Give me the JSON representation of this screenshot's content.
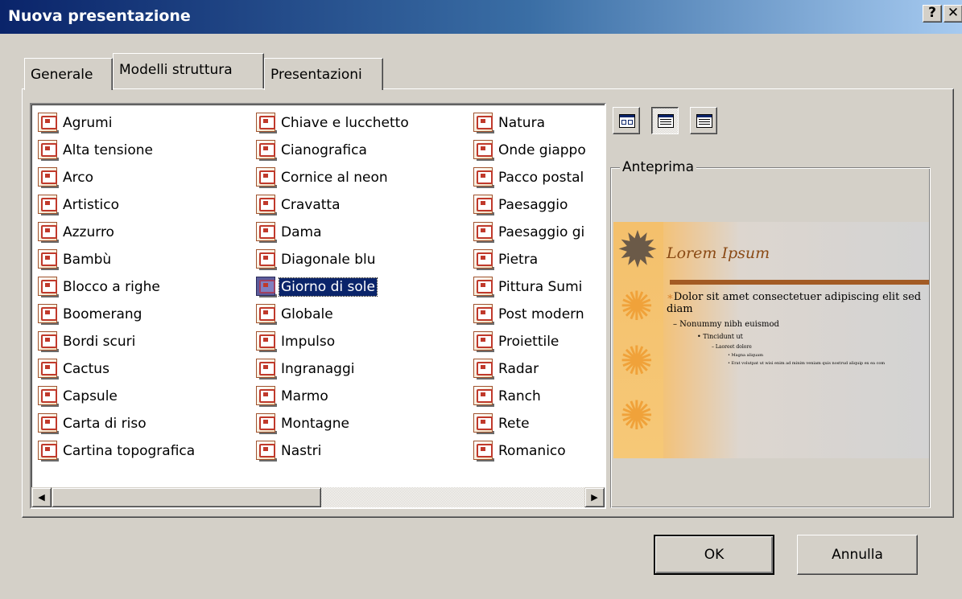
{
  "window": {
    "title": "Nuova presentazione",
    "help_glyph": "?",
    "close_glyph": "✕"
  },
  "tabs": [
    {
      "label": "Generale",
      "active": false
    },
    {
      "label": "Modelli struttura",
      "active": true
    },
    {
      "label": "Presentazioni",
      "active": false
    }
  ],
  "templates": {
    "column_1": [
      "Agrumi",
      "Alta tensione",
      "Arco",
      "Artistico",
      "Azzurro",
      "Bambù",
      "Blocco a righe",
      "Boomerang",
      "Bordi scuri",
      "Cactus",
      "Capsule",
      "Carta di riso",
      "Cartina topografica"
    ],
    "column_2": [
      "Chiave e lucchetto",
      "Cianografica",
      "Cornice al neon",
      "Cravatta",
      "Dama",
      "Diagonale blu",
      "Giorno di sole",
      "Globale",
      "Impulso",
      "Ingranaggi",
      "Marmo",
      "Montagne",
      "Nastri"
    ],
    "column_3": [
      "Natura",
      "Onde giappo",
      "Pacco postal",
      "Paesaggio",
      "Paesaggio gi",
      "Pietra",
      "Pittura Sumi",
      "Post modern",
      "Proiettile",
      "Radar",
      "Ranch",
      "Rete",
      "Romanico"
    ],
    "selected": "Giorno di sole",
    "item_icon": "design-template-icon"
  },
  "scrollbar": {
    "left_arrow": "◀",
    "right_arrow": "▶"
  },
  "view_buttons": [
    {
      "name": "large-icons-view-icon",
      "pressed": false
    },
    {
      "name": "list-view-icon",
      "pressed": true
    },
    {
      "name": "details-view-icon",
      "pressed": false
    }
  ],
  "preview": {
    "group_label": "Anteprima",
    "title": "Lorem Ipsum",
    "line1_bullet": "∗",
    "line1": "Dolor sit amet consectetuer adipiscing elit sed diam",
    "line2": "– Nonummy nibh euismod",
    "line3": "• Tincidunt ut",
    "line4": "– Laoreet dolore",
    "line5": "• Magna aliquam",
    "line6": "• Erat volutpat ut wisi enim ad minim veniam quis nostrud aliquip ex ea com",
    "accent_color": "#a35b24",
    "background_color": "#f2b45a"
  },
  "buttons": {
    "ok": "OK",
    "cancel": "Annulla"
  }
}
